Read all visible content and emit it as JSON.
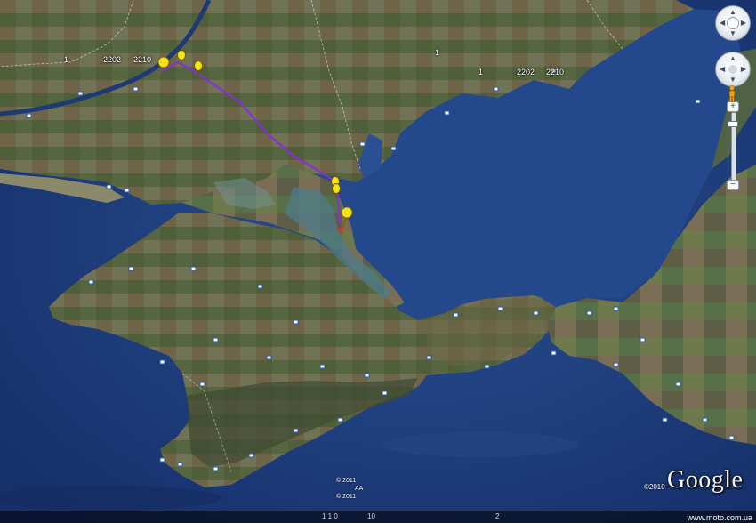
{
  "map": {
    "view": "satellite",
    "colors": {
      "sea": "#1e3d7e",
      "land": "#5a6a3e",
      "route": "#8a2be2",
      "pin": "#f5e11a"
    },
    "road_labels": [
      {
        "text": "1"
      },
      {
        "text": "2202"
      },
      {
        "text": "2210"
      },
      {
        "text": "1"
      },
      {
        "text": "1"
      },
      {
        "text": "2202"
      },
      {
        "text": "2210"
      }
    ],
    "copyright_lines": [
      "© 2011",
      "AA",
      "© 2011"
    ],
    "footer_labels": [
      "1 1  0",
      "10",
      "2"
    ]
  },
  "navigation": {
    "look_icon": "look-ring-icon",
    "move_icon": "move-ring-icon",
    "zoom_in": "+",
    "zoom_out": "−",
    "pegman_icon": "pegman-icon"
  },
  "branding": {
    "logo_text": "Google",
    "logo_year": "©2010",
    "watermark": "www.moto.com.ua"
  }
}
